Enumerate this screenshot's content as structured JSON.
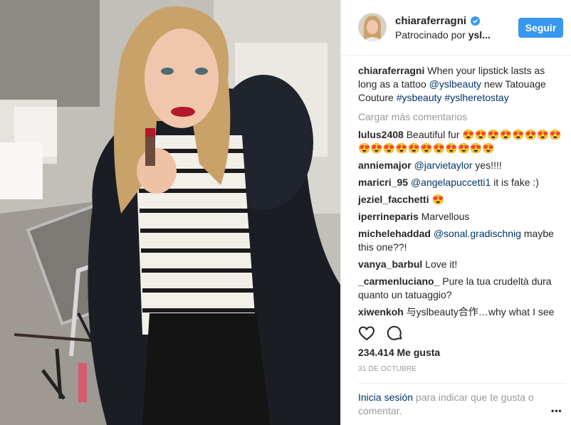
{
  "post": {
    "username": "chiaraferragni",
    "sponsor_prefix": "Patrocinado por",
    "sponsor_name": "ysl...",
    "follow_label": "Seguir",
    "caption_user": "chiaraferragni",
    "caption_text": " When your lipstick lasts as long as a tattoo ",
    "caption_mention": "@yslbeauty",
    "caption_text2": " new Tatouage Couture ",
    "caption_tag1": "#ysbeauty",
    "caption_tag2": "#yslheretostay",
    "load_more": "Cargar más comentarios"
  },
  "comments": [
    {
      "user": "lulus2408",
      "text": " Beautiful fur 😍😍😍😍😍😍😍😍😍😍😍😍😍😍😍😍😍😍😍"
    },
    {
      "user": "anniemajor",
      "pre": " ",
      "mention": "@jarvietaylor",
      "text": " yes!!!!"
    },
    {
      "user": "maricri_95",
      "pre": " ",
      "mention": "@angelapuccetti1",
      "text": " it is fake :)"
    },
    {
      "user": "jeziel_facchetti",
      "text": " 😍"
    },
    {
      "user": "iperrineparis",
      "text": " Marvellous"
    },
    {
      "user": "michelehaddad",
      "pre": " ",
      "mention": "@sonal.gradischnig",
      "text": " maybe this one??!"
    },
    {
      "user": "vanya_barbul",
      "text": " Love it!"
    },
    {
      "user": "_carmenluciano_",
      "text": " Pure la tua crudeltà dura quanto un tatuaggio?"
    },
    {
      "user": "xiwenkoh",
      "text": " 与yslbeauty合作…why what I see"
    }
  ],
  "stats": {
    "likes": "234.414 Me gusta",
    "date": "31 DE OCTUBRE"
  },
  "footer": {
    "login_link": "Inicia sesión",
    "login_text": " para indicar que te gusta o comentar.",
    "more": "•••"
  },
  "icons": {
    "heart": "heart-icon",
    "comment": "comment-icon",
    "verified": "verified-badge-icon"
  },
  "colors": {
    "accent": "#3897f0",
    "link": "#003569",
    "muted": "#999999",
    "text": "#262626"
  }
}
